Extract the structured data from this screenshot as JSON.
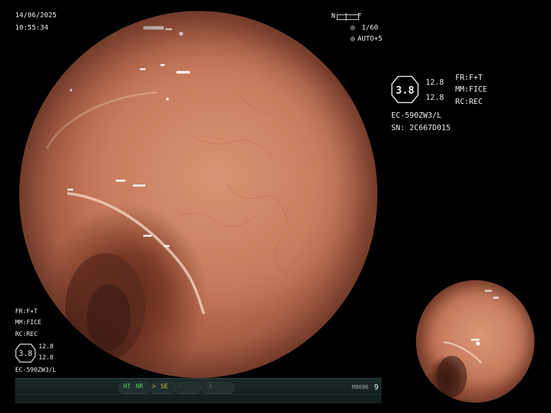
{
  "header": {
    "date": "14/06/2025",
    "time": "10:55:34"
  },
  "focus_indicator": {
    "near_label": "N",
    "far_label": "F",
    "shutter": "1/60",
    "exposure": "AUTO+5"
  },
  "right_panel": {
    "badge_value": "3.8",
    "value_top": "12.8",
    "value_bottom": "12.8",
    "fr": "FR:F+T",
    "mm": "MM:FICE",
    "rc": "RC:REC",
    "scope_model": "EC-590ZW3/L",
    "serial": "SN: 2C667D015"
  },
  "left_panel": {
    "fr": "FR:F+T",
    "mm": "MM:FICE",
    "rc": "RC:REC",
    "badge_value": "3.8",
    "value_top": "12.8",
    "value_bottom": "12.8",
    "scope_model": "EC-590ZW3/L"
  },
  "status_bar": {
    "ht": "HT",
    "nr": "NR",
    "se": "SE",
    "code": "M8696",
    "number": "9"
  },
  "colors": {
    "status_green": "#5fd05f",
    "status_yellow": "#d8c040",
    "mucosa": "#c97d60"
  }
}
